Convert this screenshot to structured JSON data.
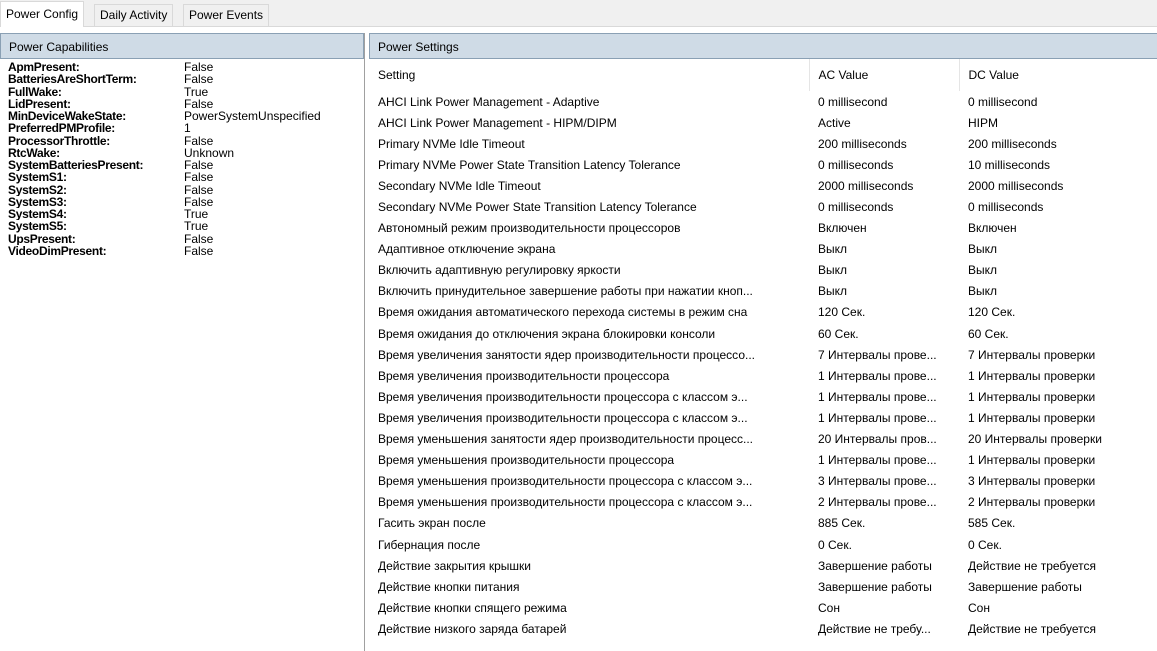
{
  "tabs": [
    "Power Config",
    "Daily Activity",
    "Power Events"
  ],
  "active_tab": 0,
  "capabilities": {
    "title": "Power Capabilities",
    "items": [
      {
        "key": "ApmPresent:",
        "value": "False"
      },
      {
        "key": "BatteriesAreShortTerm:",
        "value": "False"
      },
      {
        "key": "FullWake:",
        "value": "True"
      },
      {
        "key": "LidPresent:",
        "value": "False"
      },
      {
        "key": "MinDeviceWakeState:",
        "value": "PowerSystemUnspecified"
      },
      {
        "key": "PreferredPMProfile:",
        "value": "1"
      },
      {
        "key": "ProcessorThrottle:",
        "value": "False"
      },
      {
        "key": "RtcWake:",
        "value": "Unknown"
      },
      {
        "key": "SystemBatteriesPresent:",
        "value": "False"
      },
      {
        "key": "SystemS1:",
        "value": "False"
      },
      {
        "key": "SystemS2:",
        "value": "False"
      },
      {
        "key": "SystemS3:",
        "value": "False"
      },
      {
        "key": "SystemS4:",
        "value": "True"
      },
      {
        "key": "SystemS5:",
        "value": "True"
      },
      {
        "key": "UpsPresent:",
        "value": "False"
      },
      {
        "key": "VideoDimPresent:",
        "value": "False"
      }
    ]
  },
  "settings": {
    "title": "Power Settings",
    "columns": [
      "Setting",
      "AC Value",
      "DC Value"
    ],
    "rows": [
      [
        "AHCI Link Power Management - Adaptive",
        "0 millisecond",
        "0 millisecond"
      ],
      [
        "AHCI Link Power Management - HIPM/DIPM",
        "Active",
        "HIPM"
      ],
      [
        "Primary NVMe Idle Timeout",
        "200 milliseconds",
        "200 milliseconds"
      ],
      [
        "Primary NVMe Power State Transition Latency Tolerance",
        "0 milliseconds",
        "10 milliseconds"
      ],
      [
        "Secondary NVMe Idle Timeout",
        "2000 milliseconds",
        "2000 milliseconds"
      ],
      [
        "Secondary NVMe Power State Transition Latency Tolerance",
        "0 milliseconds",
        "0 milliseconds"
      ],
      [
        "Автономный режим производительности процессоров",
        "Включен",
        "Включен"
      ],
      [
        "Адаптивное отключение экрана",
        "Выкл",
        "Выкл"
      ],
      [
        "Включить адаптивную регулировку яркости",
        "Выкл",
        "Выкл"
      ],
      [
        "Включить принудительное завершение работы при нажатии кноп...",
        "Выкл",
        "Выкл"
      ],
      [
        "Время ожидания автоматического перехода системы в режим сна",
        "120 Сек.",
        "120 Сек."
      ],
      [
        "Время ожидания до отключения экрана блокировки консоли",
        "60 Сек.",
        "60 Сек."
      ],
      [
        "Время увеличения занятости ядер производительности процессо...",
        "7 Интервалы прове...",
        "7 Интервалы проверки"
      ],
      [
        "Время увеличения производительности процессора",
        "1 Интервалы прове...",
        "1 Интервалы проверки"
      ],
      [
        "Время увеличения производительности процессора с классом э...",
        "1 Интервалы прове...",
        "1 Интервалы проверки"
      ],
      [
        "Время увеличения производительности процессора с классом э...",
        "1 Интервалы прове...",
        "1 Интервалы проверки"
      ],
      [
        "Время уменьшения занятости ядер производительности процесс...",
        "20 Интервалы пров...",
        "20 Интервалы проверки"
      ],
      [
        "Время уменьшения производительности процессора",
        "1 Интервалы прове...",
        "1 Интервалы проверки"
      ],
      [
        "Время уменьшения производительности процессора с классом э...",
        "3 Интервалы прове...",
        "3 Интервалы проверки"
      ],
      [
        "Время уменьшения производительности процессора с классом э...",
        "2 Интервалы прове...",
        "2 Интервалы проверки"
      ],
      [
        "Гасить экран после",
        "885 Сек.",
        "585 Сек."
      ],
      [
        "Гибернация после",
        "0 Сек.",
        "0 Сек."
      ],
      [
        "Действие закрытия крышки",
        "Завершение работы",
        "Действие не требуется"
      ],
      [
        "Действие кнопки питания",
        "Завершение работы",
        "Завершение работы"
      ],
      [
        "Действие кнопки спящего режима",
        "Сон",
        "Сон"
      ],
      [
        "Действие низкого заряда батарей",
        "Действие не требу...",
        "Действие не требуется"
      ]
    ]
  }
}
